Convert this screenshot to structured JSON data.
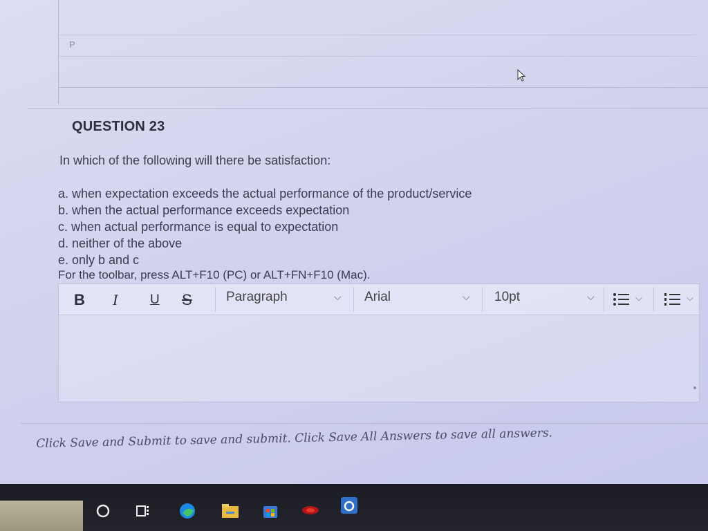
{
  "previous_answer": {
    "text": "P"
  },
  "question": {
    "title": "QUESTION 23",
    "text": "In which of the following will there be satisfaction:",
    "options": [
      "a. when expectation exceeds the actual performance of the product/service",
      "b. when the actual performance exceeds expectation",
      "c. when actual performance is equal to expectation",
      "d. neither of the above",
      "e. only b and c"
    ],
    "toolbar_hint": "For the toolbar, press ALT+F10 (PC) or ALT+FN+F10 (Mac)."
  },
  "toolbar": {
    "bold": "B",
    "italic": "I",
    "underline": "U",
    "strikethrough": "S",
    "paragraph": "Paragraph",
    "font": "Arial",
    "font_size": "10pt"
  },
  "footer": {
    "instruction": "Click Save and Submit to save and submit. Click Save All Answers to save all answers."
  },
  "taskbar": {
    "icons": [
      "search-icon",
      "task-view-icon",
      "edge-icon",
      "file-explorer-icon",
      "store-icon",
      "app-icon",
      "outlook-icon"
    ]
  }
}
